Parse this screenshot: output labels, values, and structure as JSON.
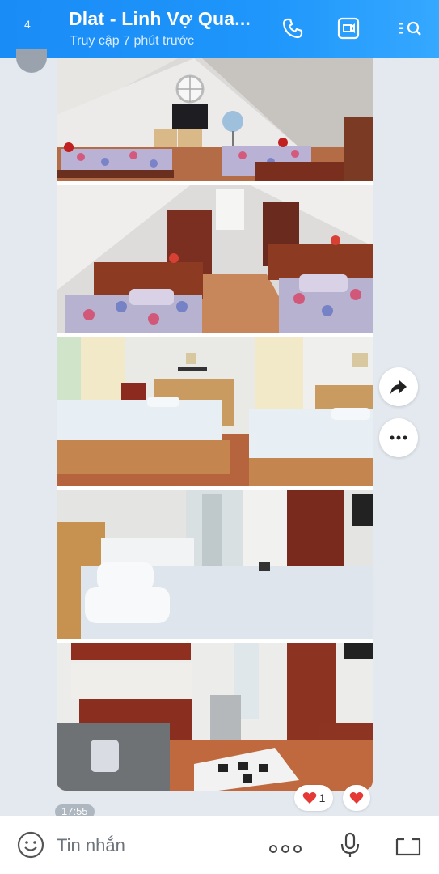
{
  "header": {
    "back_label": "4",
    "title": "Dlat - Linh Vợ Qua...",
    "status": "Truy cập 7 phút trước"
  },
  "message": {
    "time": "17:55",
    "photos": [
      "attic-room-1",
      "attic-room-2",
      "double-beds-room",
      "bed-closeup-room",
      "kitchen-living-room"
    ]
  },
  "reactions": {
    "heart_count": "1"
  },
  "composer": {
    "placeholder": "Tin nhắn"
  },
  "colors": {
    "header_blue": "#1e96fb",
    "background": "#e4e9f0",
    "heart_red": "#e53935"
  },
  "icons": [
    "back-icon",
    "phone-icon",
    "video-call-icon",
    "menu-icon",
    "forward-icon",
    "more-icon",
    "heart-icon",
    "emoji-icon",
    "mic-icon",
    "image-icon"
  ]
}
